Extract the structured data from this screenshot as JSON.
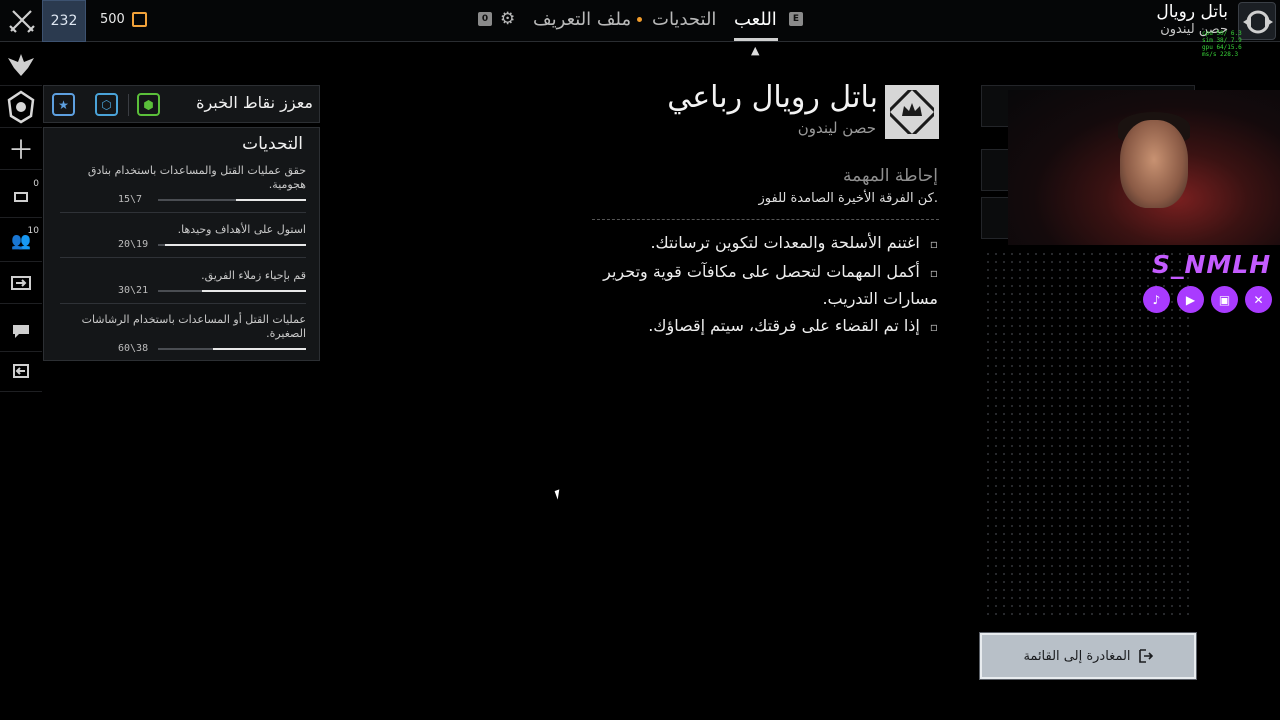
{
  "topbar": {
    "rank_level": "232",
    "currency_amount": "500",
    "tabs": [
      {
        "label": "اللعب",
        "key": "E",
        "active": true
      },
      {
        "label": "التحديات",
        "active": false
      },
      {
        "label": "ملف التعريف",
        "active": false
      }
    ],
    "settings_key": "0",
    "player": {
      "name": "باتل رويال",
      "club": "حصن ليندون"
    },
    "stats_overlay": [
      "cpu 50/ 6.3",
      "sim 38/ 7.9",
      "gpu 64/15.6",
      "ms/s 228.3"
    ]
  },
  "left_rail": {
    "counts": {
      "messages": "0",
      "party": "10"
    }
  },
  "xp_boost": {
    "title": "معزز نقاط الخبرة"
  },
  "challenges": {
    "title": "التحديات",
    "items": [
      {
        "text": "حقق عمليات القتل والمساعدات باستخدام بنادق هجومية.",
        "progress": "15\\7",
        "fraction": 0.47
      },
      {
        "text": "استول على الأهداف وحيدها.",
        "progress": "20\\19",
        "fraction": 0.95
      },
      {
        "text": "قم بإحياء زملاء الفريق.",
        "progress": "30\\21",
        "fraction": 0.7
      },
      {
        "text": "عمليات القتل أو المساعدات باستخدام الرشاشات الصغيرة.",
        "progress": "60\\38",
        "fraction": 0.63
      }
    ]
  },
  "mode": {
    "title": "باتل رويال رباعي",
    "subtitle": "حصن ليندون",
    "briefing_title": "إحاطة المهمة",
    "briefing_text": "كن الفرقة الأخيرة الصامدة للفوز.",
    "bullets": [
      "اغتنم الأسلحة والمعدات لتكوين ترسانتك.",
      "أكمل المهمات لتحصل على مكافآت قوية وتحرير مسارات التدريب.",
      "إذا تم القضاء على فرقتك، سيتم إقصاؤك."
    ]
  },
  "overlay": {
    "streamer_name": "S_NMLH",
    "social_icons": [
      "tiktok-icon",
      "youtube-icon",
      "twitch-icon",
      "x-icon"
    ],
    "accent_color": "#a93bff"
  },
  "actions": {
    "leave_label": "المغادرة إلى القائمة"
  }
}
